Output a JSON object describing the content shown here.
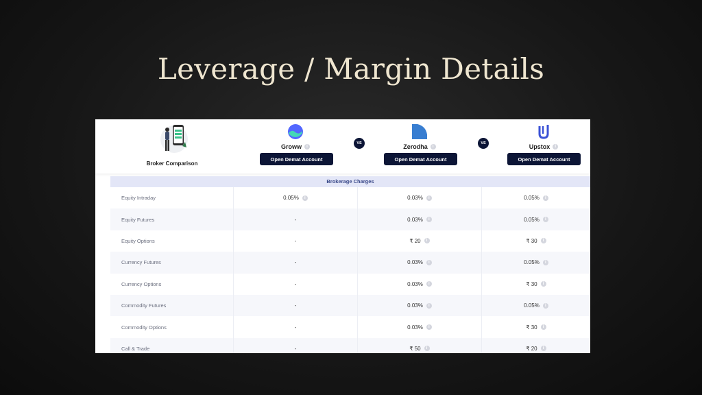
{
  "title": "Leverage / Margin Details",
  "header": {
    "broker_comparison_label": "Broker Comparison",
    "vs_label": "VS",
    "brokers": [
      {
        "name": "Groww",
        "button": "Open Demat Account",
        "logo_icon": "groww-logo-icon",
        "color": "#5367ff"
      },
      {
        "name": "Zerodha",
        "button": "Open Demat Account",
        "logo_icon": "zerodha-logo-icon",
        "color": "#387ed1"
      },
      {
        "name": "Upstox",
        "button": "Open Demat Account",
        "logo_icon": "upstox-logo-icon",
        "color": "#3a51d6"
      }
    ]
  },
  "table": {
    "section": "Brokerage Charges",
    "rows": [
      {
        "label": "Equity Intraday",
        "values": [
          "0.05%",
          "0.03%",
          "0.05%"
        ]
      },
      {
        "label": "Equity Futures",
        "values": [
          "-",
          "0.03%",
          "0.05%"
        ]
      },
      {
        "label": "Equity Options",
        "values": [
          "-",
          "₹ 20",
          "₹ 30"
        ]
      },
      {
        "label": "Currency Futures",
        "values": [
          "-",
          "0.03%",
          "0.05%"
        ]
      },
      {
        "label": "Currency Options",
        "values": [
          "-",
          "0.03%",
          "₹ 30"
        ]
      },
      {
        "label": "Commodity Futures",
        "values": [
          "-",
          "0.03%",
          "0.05%"
        ]
      },
      {
        "label": "Commodity Options",
        "values": [
          "-",
          "0.03%",
          "₹ 30"
        ]
      },
      {
        "label": "Call & Trade",
        "values": [
          "-",
          "₹ 50",
          "₹ 20"
        ]
      }
    ]
  },
  "colors": {
    "button_bg": "#0c1536",
    "section_bg": "#e3e6f7",
    "title": "#efe6d0"
  }
}
